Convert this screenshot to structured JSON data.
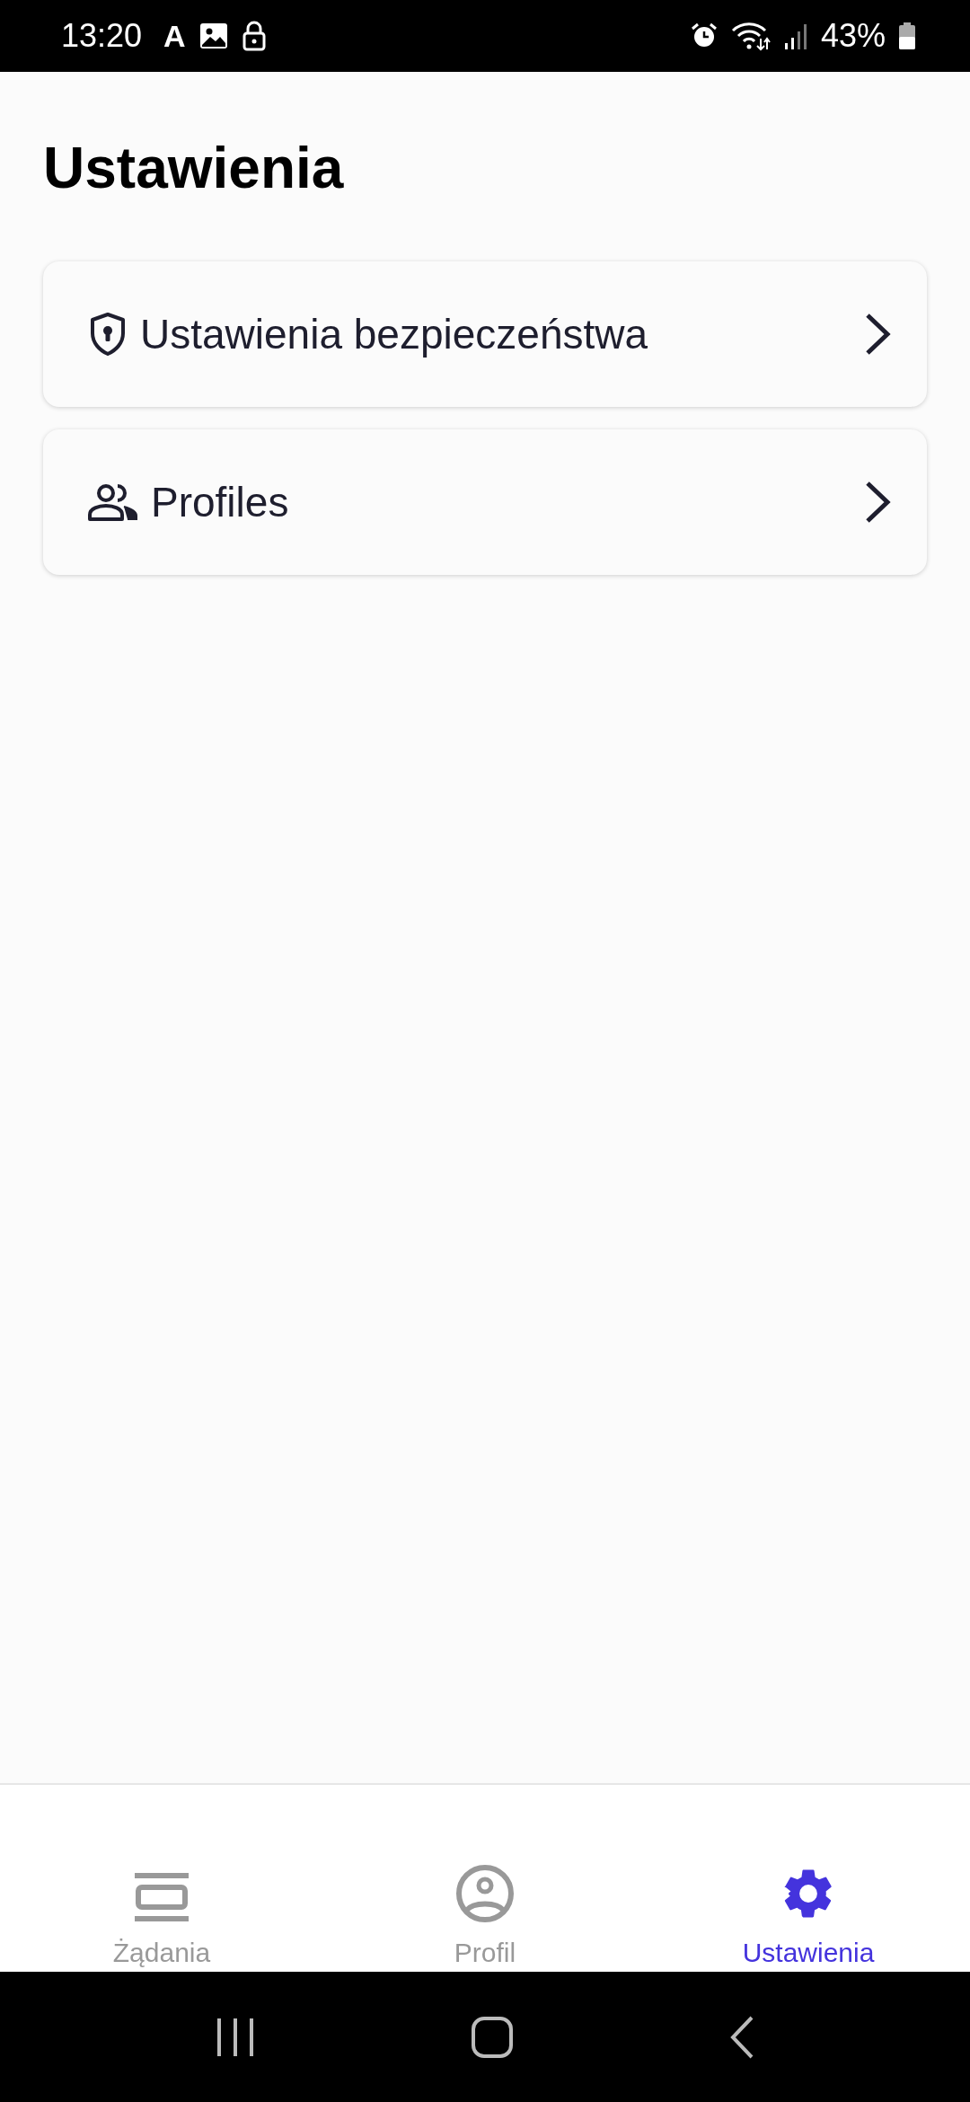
{
  "status_bar": {
    "time": "13:20",
    "letter": "A",
    "battery": "43%"
  },
  "title": "Ustawienia",
  "items": [
    {
      "kind": "shield",
      "label": "Ustawienia bezpieczeństwa"
    },
    {
      "kind": "people",
      "label": "Profiles"
    }
  ],
  "tabs": [
    {
      "kind": "list",
      "label": "Żądania",
      "selected": false
    },
    {
      "kind": "profile",
      "label": "Profil",
      "selected": false
    },
    {
      "kind": "gear",
      "label": "Ustawienia",
      "selected": true
    }
  ]
}
